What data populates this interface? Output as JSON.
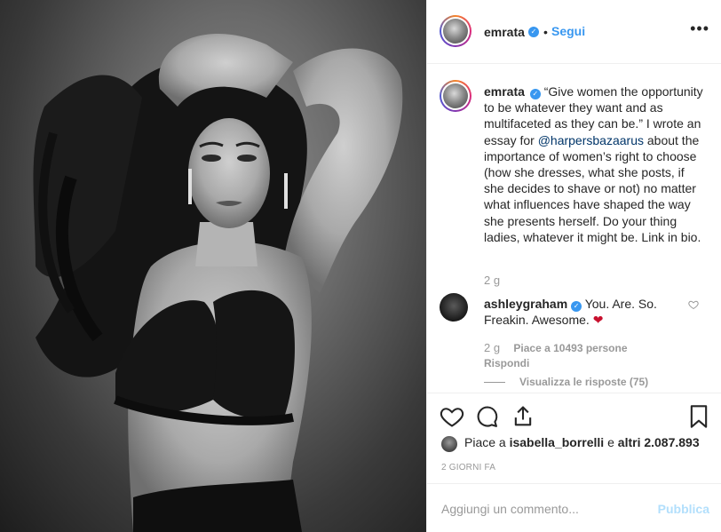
{
  "post": {
    "username": "emrata",
    "follow_label": "Segui",
    "separator": "•",
    "more": "•••"
  },
  "caption": {
    "username": "emrata",
    "text_before_mention": "“Give women the opportunity to be whatever they want and as multifaceted as they can be.” I wrote an essay for ",
    "mention": "@harpersbazaarus",
    "text_after_mention": " about the importance of women’s right to choose (how she dresses, what she posts, if she decides to shave or not) no matter what influences have shaped the way she presents herself. Do your thing ladies, whatever it might be. Link in bio.",
    "time": "2 g"
  },
  "reply": {
    "username": "ashleygraham",
    "text": "You. Are. So. Freakin. Awesome.",
    "emoji": "❤",
    "time": "2 g",
    "likes": "Piace a 10493 persone",
    "reply_label": "Rispondi",
    "view_replies": "Visualizza le risposte (75)"
  },
  "liked_by": {
    "prefix": "Piace a ",
    "user": "isabella_borrelli",
    "middle": " e ",
    "others": "altri 2.087.893"
  },
  "date_label": "2 GIORNI FA",
  "comment_box": {
    "placeholder": "Aggiungi un commento...",
    "publish": "Pubblica"
  },
  "colors": {
    "accent": "#3897f0",
    "mention": "#003569",
    "muted": "#999999",
    "publish_disabled": "#b2dffc"
  },
  "icons": {
    "like": "heart-outline-icon",
    "comment": "comment-bubble-icon",
    "share": "share-icon",
    "save": "bookmark-icon",
    "verified": "verified-badge-icon"
  }
}
